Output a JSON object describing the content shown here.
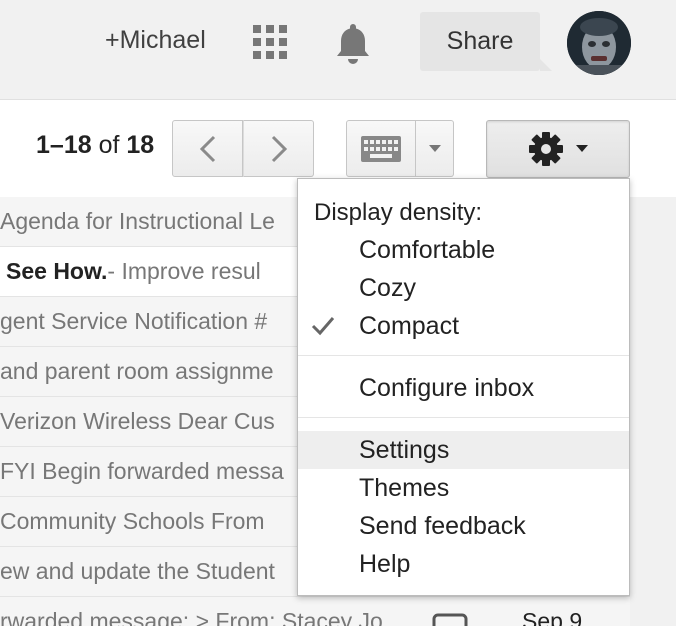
{
  "topbar": {
    "user_name": "+Michael",
    "share_label": "Share",
    "icons": [
      "apps-grid-icon",
      "notifications-bell-icon",
      "avatar"
    ]
  },
  "toolbar": {
    "pager": {
      "start": "1",
      "dash": "–",
      "end": "18",
      "of": " of ",
      "total": "18"
    },
    "icons": [
      "chevron-left-icon",
      "chevron-right-icon",
      "keyboard-icon",
      "caret-down-icon",
      "gear-icon"
    ]
  },
  "emails": [
    {
      "snippet": "Agenda for Instructional Le",
      "subject": ""
    },
    {
      "subject": "See How.",
      "snippet": " - Improve resul"
    },
    {
      "snippet": "gent Service Notification #",
      "subject": ""
    },
    {
      "snippet": "and parent room assignme",
      "subject": ""
    },
    {
      "snippet": "Verizon Wireless Dear Cus",
      "subject": ""
    },
    {
      "snippet": "FYI Begin forwarded messa",
      "subject": ""
    },
    {
      "snippet": "Community Schools From",
      "subject": ""
    },
    {
      "snippet": "ew and update the Student",
      "subject": ""
    },
    {
      "snippet": "rwarded message: > From: Stacey Jo",
      "subject": "",
      "date": "Sep 9"
    }
  ],
  "menu": {
    "heading": "Display density:",
    "density_options": [
      "Comfortable",
      "Cozy",
      "Compact"
    ],
    "selected_density": "Compact",
    "configure_inbox": "Configure inbox",
    "settings": "Settings",
    "themes": "Themes",
    "send_feedback": "Send feedback",
    "help": "Help",
    "hovered_item": "Settings"
  },
  "colors": {
    "topbar_bg": "#f1f1f1",
    "button_bg": "#ececec",
    "menu_hover": "#eeeeee",
    "icon_gray": "#777777"
  }
}
